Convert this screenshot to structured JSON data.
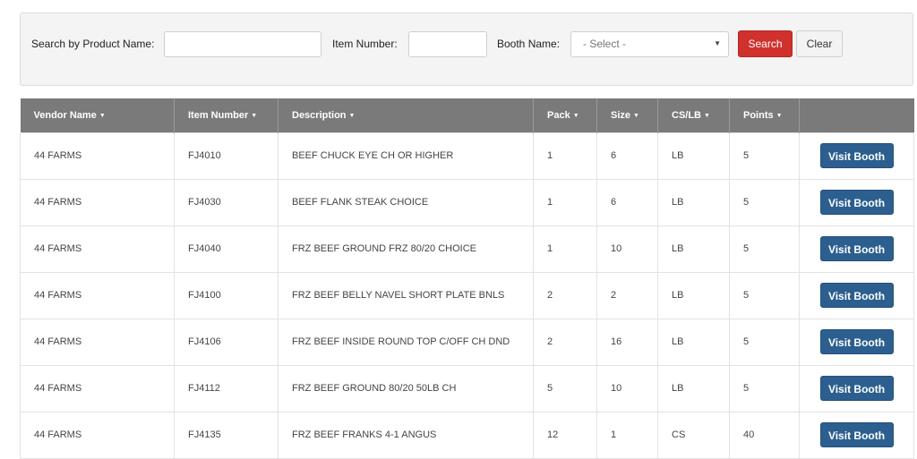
{
  "filters": {
    "product_label": "Search by Product Name:",
    "product_value": "",
    "item_label": "Item Number:",
    "item_value": "",
    "booth_label": "Booth Name:",
    "booth_selected": "- Select -",
    "search_label": "Search",
    "clear_label": "Clear"
  },
  "table": {
    "columns": [
      "Vendor Name",
      "Item Number",
      "Description",
      "Pack",
      "Size",
      "CS/LB",
      "Points",
      ""
    ],
    "action_label": "Visit Booth",
    "rows": [
      [
        "44 FARMS",
        "FJ4010",
        "BEEF CHUCK EYE CH OR HIGHER",
        "1",
        "6",
        "LB",
        "5"
      ],
      [
        "44 FARMS",
        "FJ4030",
        "BEEF FLANK STEAK CHOICE",
        "1",
        "6",
        "LB",
        "5"
      ],
      [
        "44 FARMS",
        "FJ4040",
        "FRZ BEEF GROUND FRZ 80/20 CHOICE",
        "1",
        "10",
        "LB",
        "5"
      ],
      [
        "44 FARMS",
        "FJ4100",
        "FRZ BEEF BELLY NAVEL SHORT PLATE BNLS",
        "2",
        "2",
        "LB",
        "5"
      ],
      [
        "44 FARMS",
        "FJ4106",
        "FRZ BEEF INSIDE ROUND TOP C/OFF CH DND",
        "2",
        "16",
        "LB",
        "5"
      ],
      [
        "44 FARMS",
        "FJ4112",
        "FRZ BEEF GROUND 80/20 50LB CH",
        "5",
        "10",
        "LB",
        "5"
      ],
      [
        "44 FARMS",
        "FJ4135",
        "FRZ BEEF FRANKS 4-1 ANGUS",
        "12",
        "1",
        "CS",
        "40"
      ]
    ]
  },
  "colors": {
    "search_button": "#d0312d",
    "visit_button": "#2c5f8f",
    "header_bg": "#7a7a7a"
  }
}
